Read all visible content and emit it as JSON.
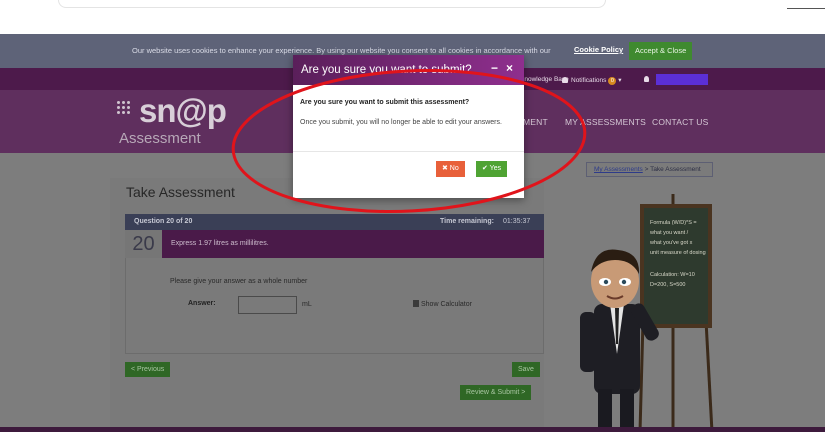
{
  "cookie": {
    "text": "Our website uses cookies to enhance your experience. By using our website you consent to all cookies in accordance with our",
    "policy_link": "Cookie Policy",
    "accept_button": "Accept & Close"
  },
  "topnav": {
    "knowledge_base": "Knowledge Base",
    "notifications": "Notifications",
    "notifications_count": "0"
  },
  "header": {
    "logo": "sn@p",
    "logo_sub": "Assessment",
    "nav": [
      "MENT",
      "MY ASSESSMENTS",
      "CONTACT US"
    ]
  },
  "breadcrumb": {
    "link": "My Assessments",
    "separator": " > ",
    "current": "Take Assessment"
  },
  "assessment": {
    "title": "Take Assessment",
    "question_label": "Question 20 of 20",
    "time_label": "Time remaining:",
    "time_value": "01:35:37",
    "question_number": "20",
    "question_text": "Express 1.97 litres as millilitres.",
    "instruction": "Please give your answer as a whole number",
    "answer_label": "Answer:",
    "answer_value": "",
    "unit": "mL",
    "calculator": "Show Calculator",
    "previous_button": "< Previous",
    "save_button": "Save",
    "review_button": "Review & Submit >"
  },
  "chalkboard": {
    "lines": [
      "Formula (W/D)*S =",
      "what you want /",
      "what you've got x",
      "unit measure of dosing",
      "Calculation: W=10",
      "D=200, S=500"
    ]
  },
  "modal": {
    "title": "Are you sure you want to submit?",
    "minimize": "−",
    "close": "×",
    "question": "Are you sure you want to submit this assessment?",
    "message": "Once you submit, you will no longer be able to edit your answers.",
    "no_button": "✖ No",
    "yes_button": "✔ Yes"
  },
  "colors": {
    "header_purple": "#5f2f5e",
    "modal_gradient_start": "#5a1f5a",
    "modal_gradient_end": "#8f2f8e",
    "no_red": "#e8603a",
    "yes_green": "#4fa333",
    "annotation_red": "#e0141b"
  }
}
